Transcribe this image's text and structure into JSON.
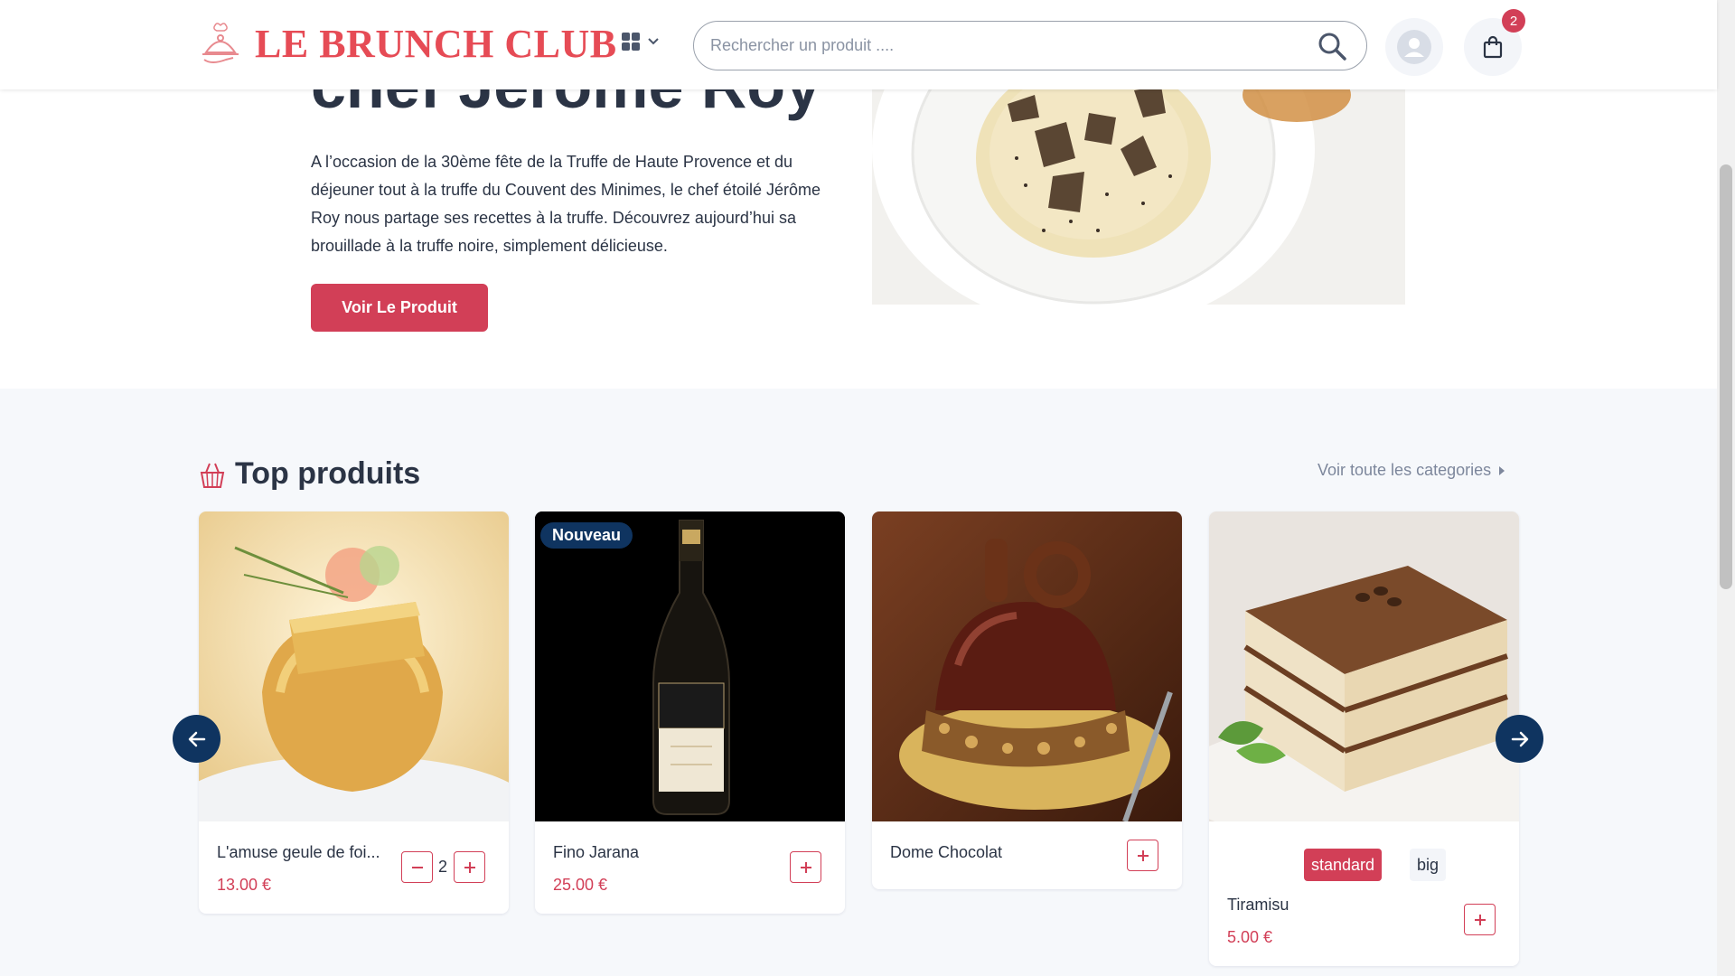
{
  "header": {
    "logo_text": "LE BRUNCH CLUB",
    "search_placeholder": "Rechercher un produit ....",
    "cart_count": "2"
  },
  "hero": {
    "title": "chef Jérôme Roy",
    "text": "A l’occasion de la 30ème fête de la Truffe de Haute Provence et du déjeuner tout à la truffe du Couvent des Minimes, le chef étoilé Jérôme Roy nous partage ses recettes à la truffe. Découvrez aujourd’hui sa brouillade à la truffe noire, simplement délicieuse.",
    "button_label": "Voir Le Produit"
  },
  "top_products": {
    "title": "Top produits",
    "see_all_label": "Voir toute les categories",
    "products": [
      {
        "name": "L'amuse geule de foi...",
        "price": "13.00 €",
        "quantity": "2"
      },
      {
        "name": "Fino Jarana",
        "price": "25.00 €",
        "tag": "Nouveau"
      },
      {
        "name": "Dome Chocolat",
        "price": ""
      },
      {
        "name": "Tiramisu",
        "price": "5.00 €",
        "sizes": [
          "standard",
          "big"
        ],
        "selected_size": "standard"
      }
    ]
  },
  "colors": {
    "accent": "#d23f57",
    "logo": "#e64b55",
    "navy": "#0f3460",
    "text": "#2b3445",
    "section_bg": "#f6f8fb"
  }
}
